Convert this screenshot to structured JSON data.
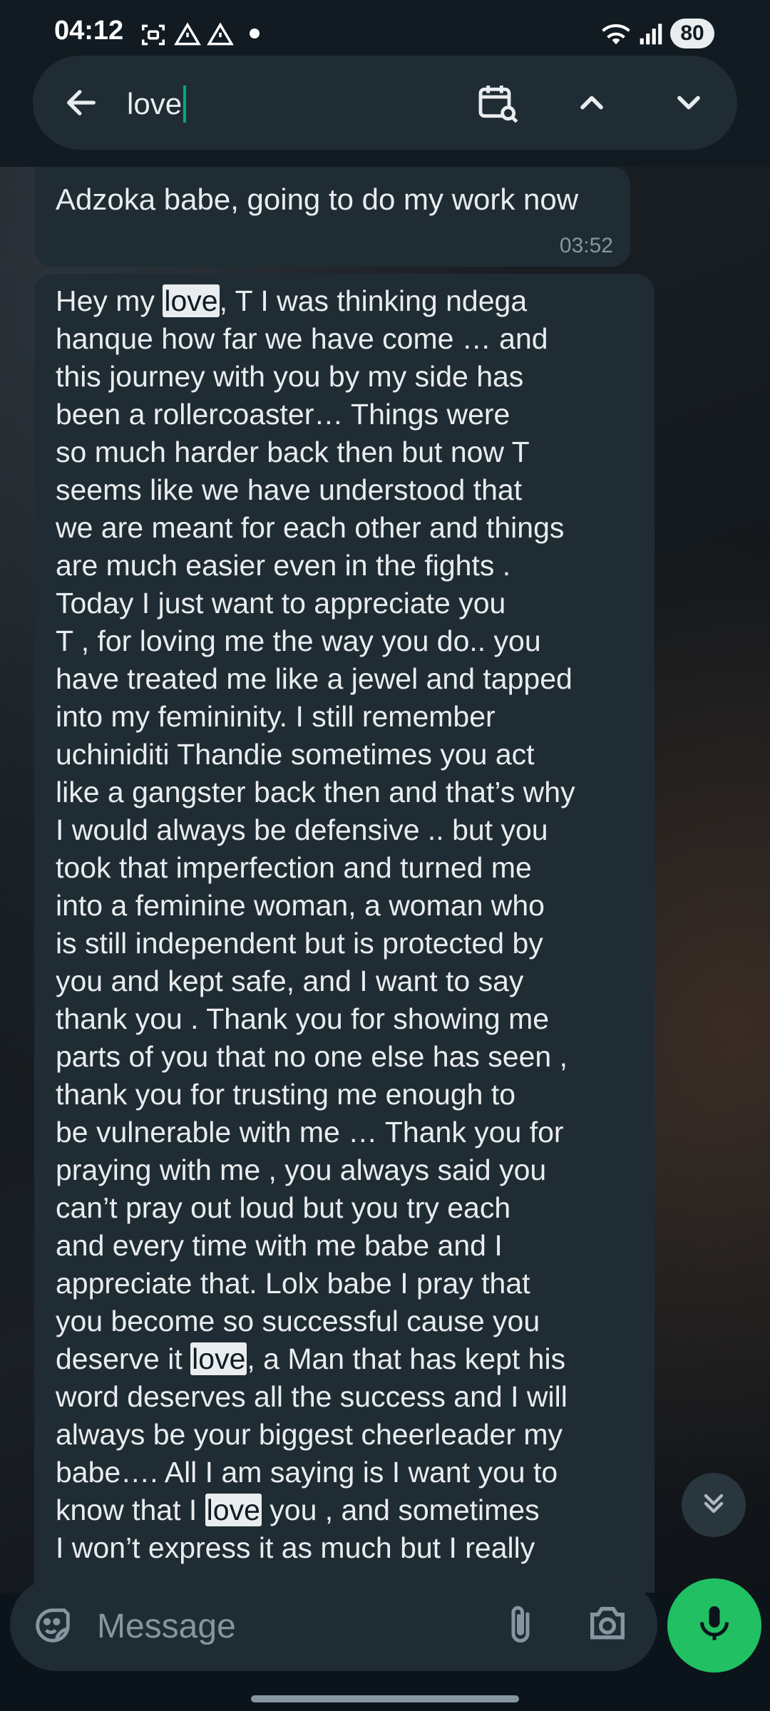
{
  "status_bar": {
    "time": "04:12",
    "battery": "80",
    "icons": [
      "screenshot-icon",
      "alert-triangle-icon",
      "alert-triangle-icon",
      "dot-icon",
      "wifi-icon",
      "signal-icon"
    ]
  },
  "search": {
    "query": "love",
    "icons": [
      "back-arrow-icon",
      "calendar-search-icon",
      "chevron-up-icon",
      "chevron-down-icon"
    ]
  },
  "messages": [
    {
      "text": "Adzoka babe, going to do my work now",
      "time": "03:52"
    },
    {
      "segments": [
        "Hey my ",
        "love",
        ", T I was thinking ndega\nhanque how far we have come … and\nthis journey with you by my side has\nbeen a rollercoaster… Things were\nso much harder back then but now T\nseems like we have understood that\nwe are meant for each other and things\nare much easier even in the fights .\nToday I just want to appreciate you\nT , for loving me the way you do.. you\nhave treated me like a jewel and tapped\ninto my femininity. I still remember\nuchiniditi Thandie sometimes you act\nlike a gangster back then and that’s why\nI would always be defensive .. but you\ntook that imperfection and turned me\ninto a feminine woman, a woman who\nis still independent but is protected by\nyou and kept safe, and I want to say\nthank you . Thank you for showing me\nparts of you that no one else has seen ,\nthank you for trusting me enough to\nbe vulnerable with me … Thank you for\npraying with me , you always said you\ncan’t pray out loud but you try each\nand every time with me babe and I\nappreciate that. Lolx babe I pray that\nyou become so successful cause you\ndeserve it ",
        "love",
        ", a Man that has kept his\nword deserves all the success and I will\nalways be your biggest cheerleader my\nbabe…. All I am saying is I want you to\nknow that I ",
        "love",
        " you , and sometimes\nI won’t express it as much but I really"
      ]
    }
  ],
  "composer": {
    "placeholder": "Message",
    "icons": [
      "sticker-icon",
      "paperclip-icon",
      "camera-icon",
      "microphone-icon"
    ]
  },
  "colors": {
    "accent": "#21c063",
    "caret": "#00a884",
    "bubble": "#202c33",
    "header": "#111b21"
  }
}
